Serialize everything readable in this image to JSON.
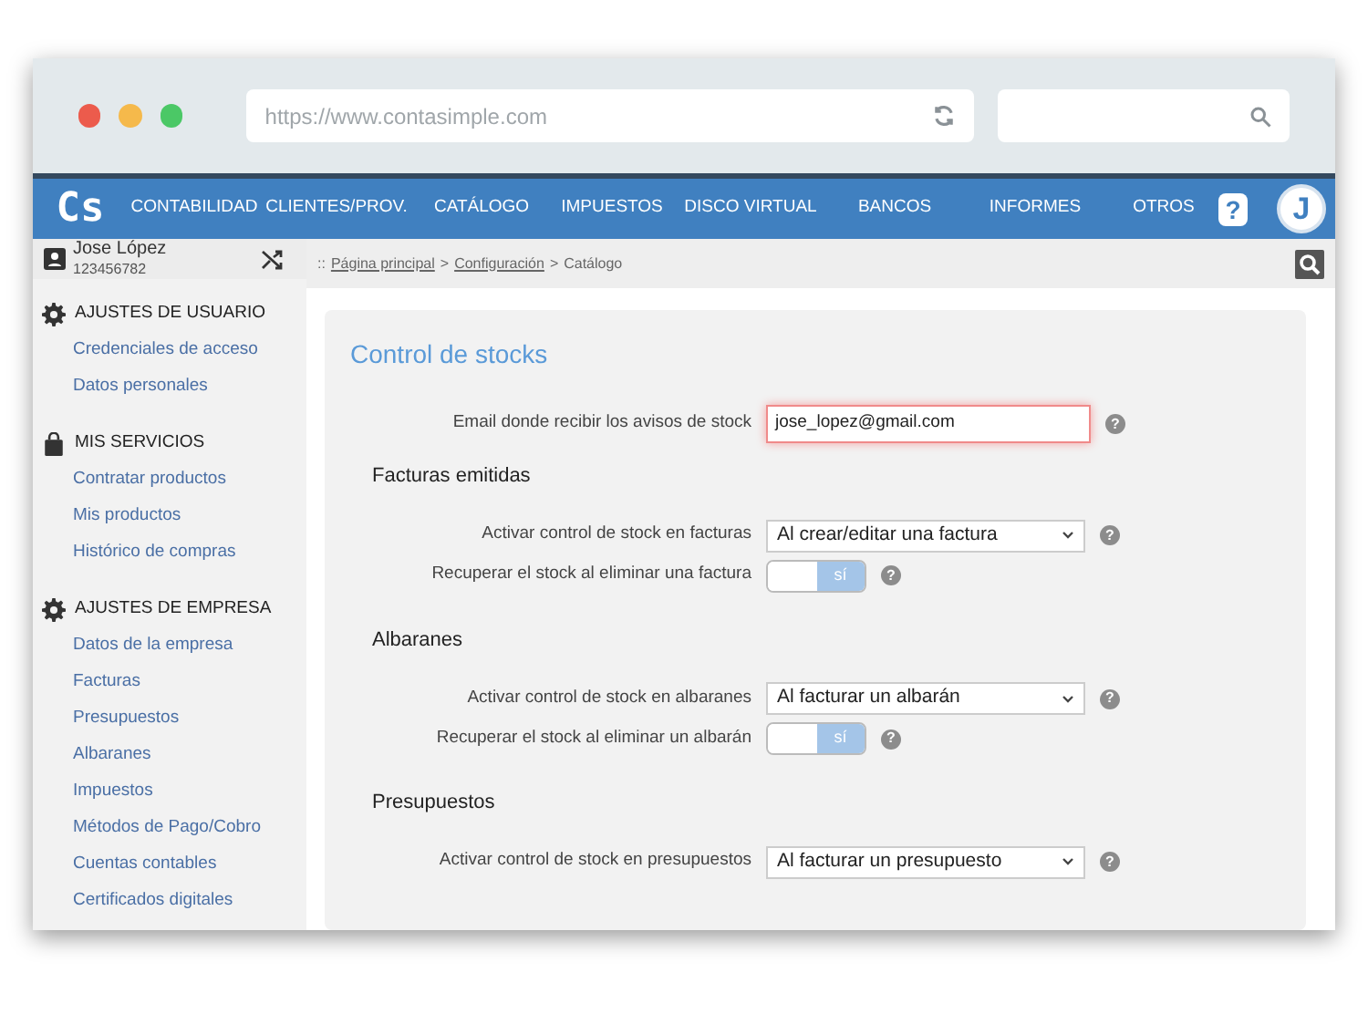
{
  "browser": {
    "url": "https://www.contasimple.com"
  },
  "logo": "Cs",
  "nav": [
    "CONTABILIDAD",
    "CLIENTES/PROV.",
    "CATÁLOGO",
    "IMPUESTOS",
    "DISCO VIRTUAL",
    "BANCOS",
    "INFORMES",
    "OTROS"
  ],
  "help_button": "?",
  "avatar": "J",
  "user": {
    "name": "Jose López",
    "id": "123456782"
  },
  "breadcrumb": {
    "prefix": "::",
    "links": [
      "Página principal",
      "Configuración"
    ],
    "current": "Catálogo",
    "separator": ">"
  },
  "sidebar": [
    {
      "heading": "AJUSTES DE USUARIO",
      "kind": "gear",
      "items": [
        "Credenciales de acceso",
        "Datos personales"
      ]
    },
    {
      "heading": "MIS SERVICIOS",
      "kind": "bag",
      "items": [
        "Contratar productos",
        "Mis productos",
        "Histórico de compras"
      ]
    },
    {
      "heading": "AJUSTES DE EMPRESA",
      "kind": "gear",
      "items": [
        "Datos de la empresa",
        "Facturas",
        "Presupuestos",
        "Albaranes",
        "Impuestos",
        "Métodos de Pago/Cobro",
        "Cuentas contables",
        "Certificados digitales"
      ]
    }
  ],
  "panel": {
    "title": "Control de stocks",
    "email": {
      "label": "Email donde recibir los avisos de stock",
      "value": "jose_lopez@gmail.com",
      "invalid": true,
      "help": "?"
    },
    "sections": [
      {
        "title": "Facturas emitidas",
        "rows": [
          {
            "kind": "select",
            "label": "Activar control de stock en facturas",
            "value": "Al crear/editar una factura",
            "help": "?"
          },
          {
            "kind": "toggle",
            "label": "Recuperar el stock al eliminar una factura",
            "text": "sí",
            "on": true,
            "help": "?"
          }
        ]
      },
      {
        "title": "Albaranes",
        "rows": [
          {
            "kind": "select",
            "label": "Activar control de stock en albaranes",
            "value": "Al facturar un albarán",
            "help": "?"
          },
          {
            "kind": "toggle",
            "label": "Recuperar el stock al eliminar un albarán",
            "text": "sí",
            "on": true,
            "help": "?"
          }
        ]
      },
      {
        "title": "Presupuestos",
        "rows": [
          {
            "kind": "select",
            "label": "Activar control de stock en presupuestos",
            "value": "Al facturar un presupuesto",
            "help": "?"
          }
        ]
      }
    ]
  }
}
